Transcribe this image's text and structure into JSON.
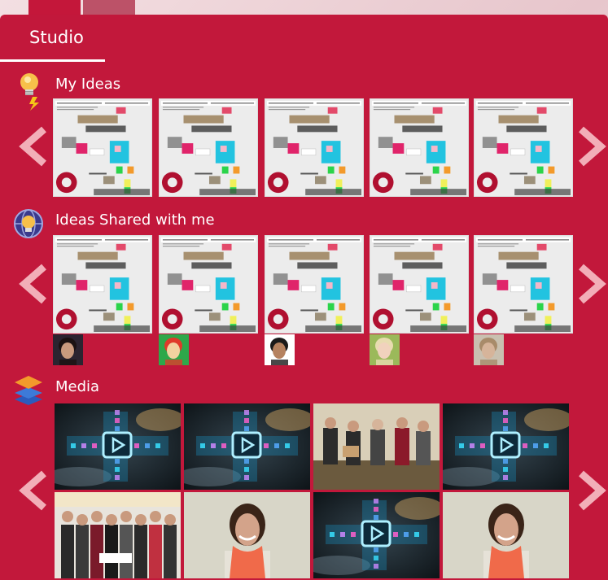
{
  "studio": {
    "title": "Studio"
  },
  "sections": {
    "my_ideas": {
      "title": "My Ideas",
      "icon": "lightbulb-icon",
      "count": 5
    },
    "shared": {
      "title": "Ideas Shared with me",
      "icon": "globe-lightbulb-icon",
      "count": 5
    },
    "media": {
      "title": "Media",
      "icon": "layers-icon",
      "count": 8
    }
  },
  "colors": {
    "panel": "#c2183b",
    "arrow": "#f2aeb8",
    "accent": "#ffffff"
  }
}
